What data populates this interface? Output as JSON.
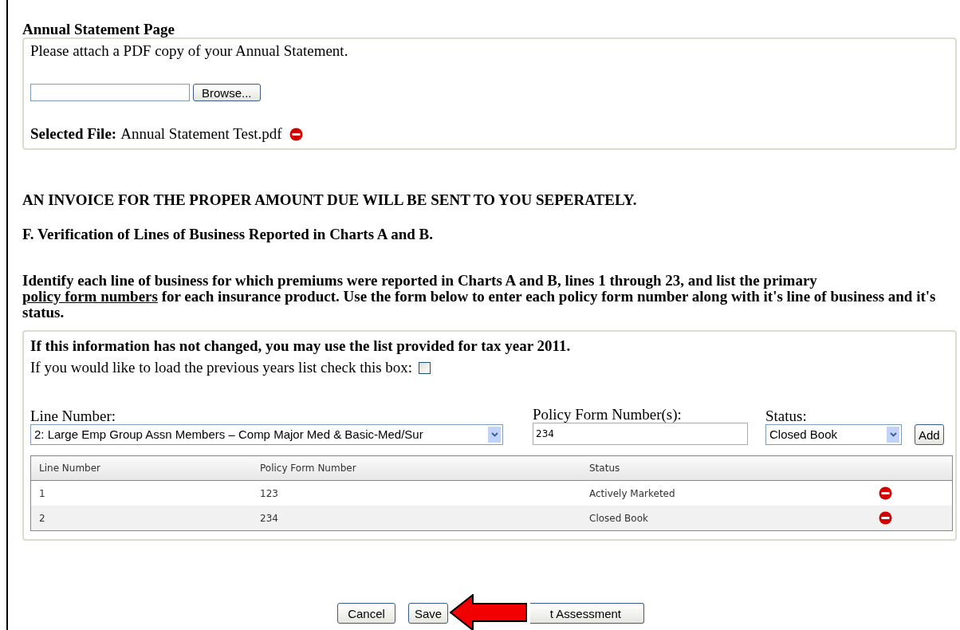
{
  "attachment": {
    "title": "Annual Statement Page",
    "instruction": "Please attach a PDF copy of your Annual Statement.",
    "browse_button": "Browse...",
    "selected_label": "Selected File:",
    "selected_file": "Annual Statement Test.pdf"
  },
  "invoice_notice": "AN INVOICE FOR THE PROPER AMOUNT DUE WILL BE SENT TO YOU SEPERATELY.",
  "section_heading": "F. Verification of Lines of Business Reported in Charts A and B.",
  "instructions": {
    "before": "Identify each line of business for which premiums were reported in Charts A and B, lines 1 through 23, and list the primary ",
    "link": "policy form numbers",
    "after": " for each insurance product. Use the form below to enter each policy form number along with it's line of business and it's status."
  },
  "policy_panel": {
    "note": "If this information has not changed, you may use the list provided for tax year 2011.",
    "load_previous_label": "If you would like to load the previous years list check this box:",
    "load_previous_checked": false,
    "line_number_label": "Line Number:",
    "line_number_value": "2: Large Emp Group Assn Members – Comp Major Med & Basic-Med/Sur",
    "policy_label": "Policy Form Number(s):",
    "policy_value": "234",
    "status_label": "Status:",
    "status_value": "Closed Book",
    "add_button": "Add"
  },
  "table": {
    "columns": [
      "Line Number",
      "Policy Form Number",
      "Status"
    ],
    "rows": [
      {
        "line": "1",
        "policy": "123",
        "status": "Actively Marketed"
      },
      {
        "line": "2",
        "policy": "234",
        "status": "Closed Book"
      }
    ]
  },
  "buttons": [
    "Cancel",
    "Save",
    "t Assessment"
  ]
}
